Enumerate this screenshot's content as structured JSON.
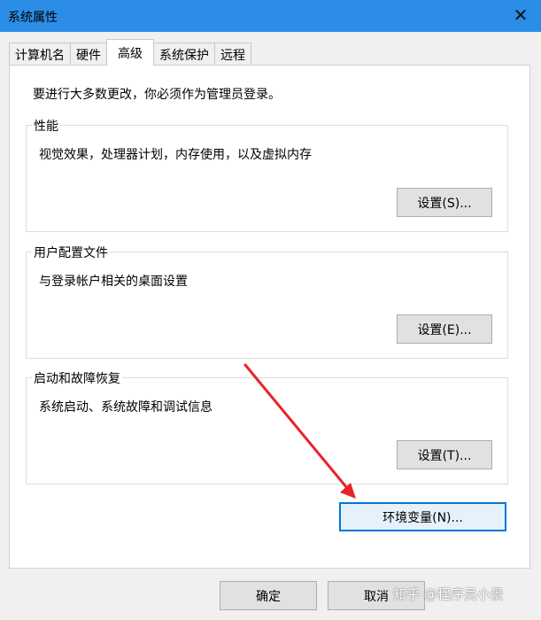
{
  "window": {
    "title": "系统属性",
    "close_icon": "✕"
  },
  "tabs": [
    {
      "label": "计算机名"
    },
    {
      "label": "硬件"
    },
    {
      "label": "高级"
    },
    {
      "label": "系统保护"
    },
    {
      "label": "远程"
    }
  ],
  "intro": "要进行大多数更改，你必须作为管理员登录。",
  "performance": {
    "title": "性能",
    "description": "视觉效果，处理器计划，内存使用，以及虚拟内存",
    "button": "设置(S)..."
  },
  "user_profiles": {
    "title": "用户配置文件",
    "description": "与登录帐户相关的桌面设置",
    "button": "设置(E)..."
  },
  "startup_recovery": {
    "title": "启动和故障恢复",
    "description": "系统启动、系统故障和调试信息",
    "button": "设置(T)..."
  },
  "env_button": "环境变量(N)...",
  "footer": {
    "ok": "确定",
    "cancel": "取消"
  },
  "watermark": "知乎 @程序员小景",
  "colors": {
    "titlebar": "#2b8de6",
    "arrow": "#e8232a",
    "primary_border": "#0078d7"
  }
}
